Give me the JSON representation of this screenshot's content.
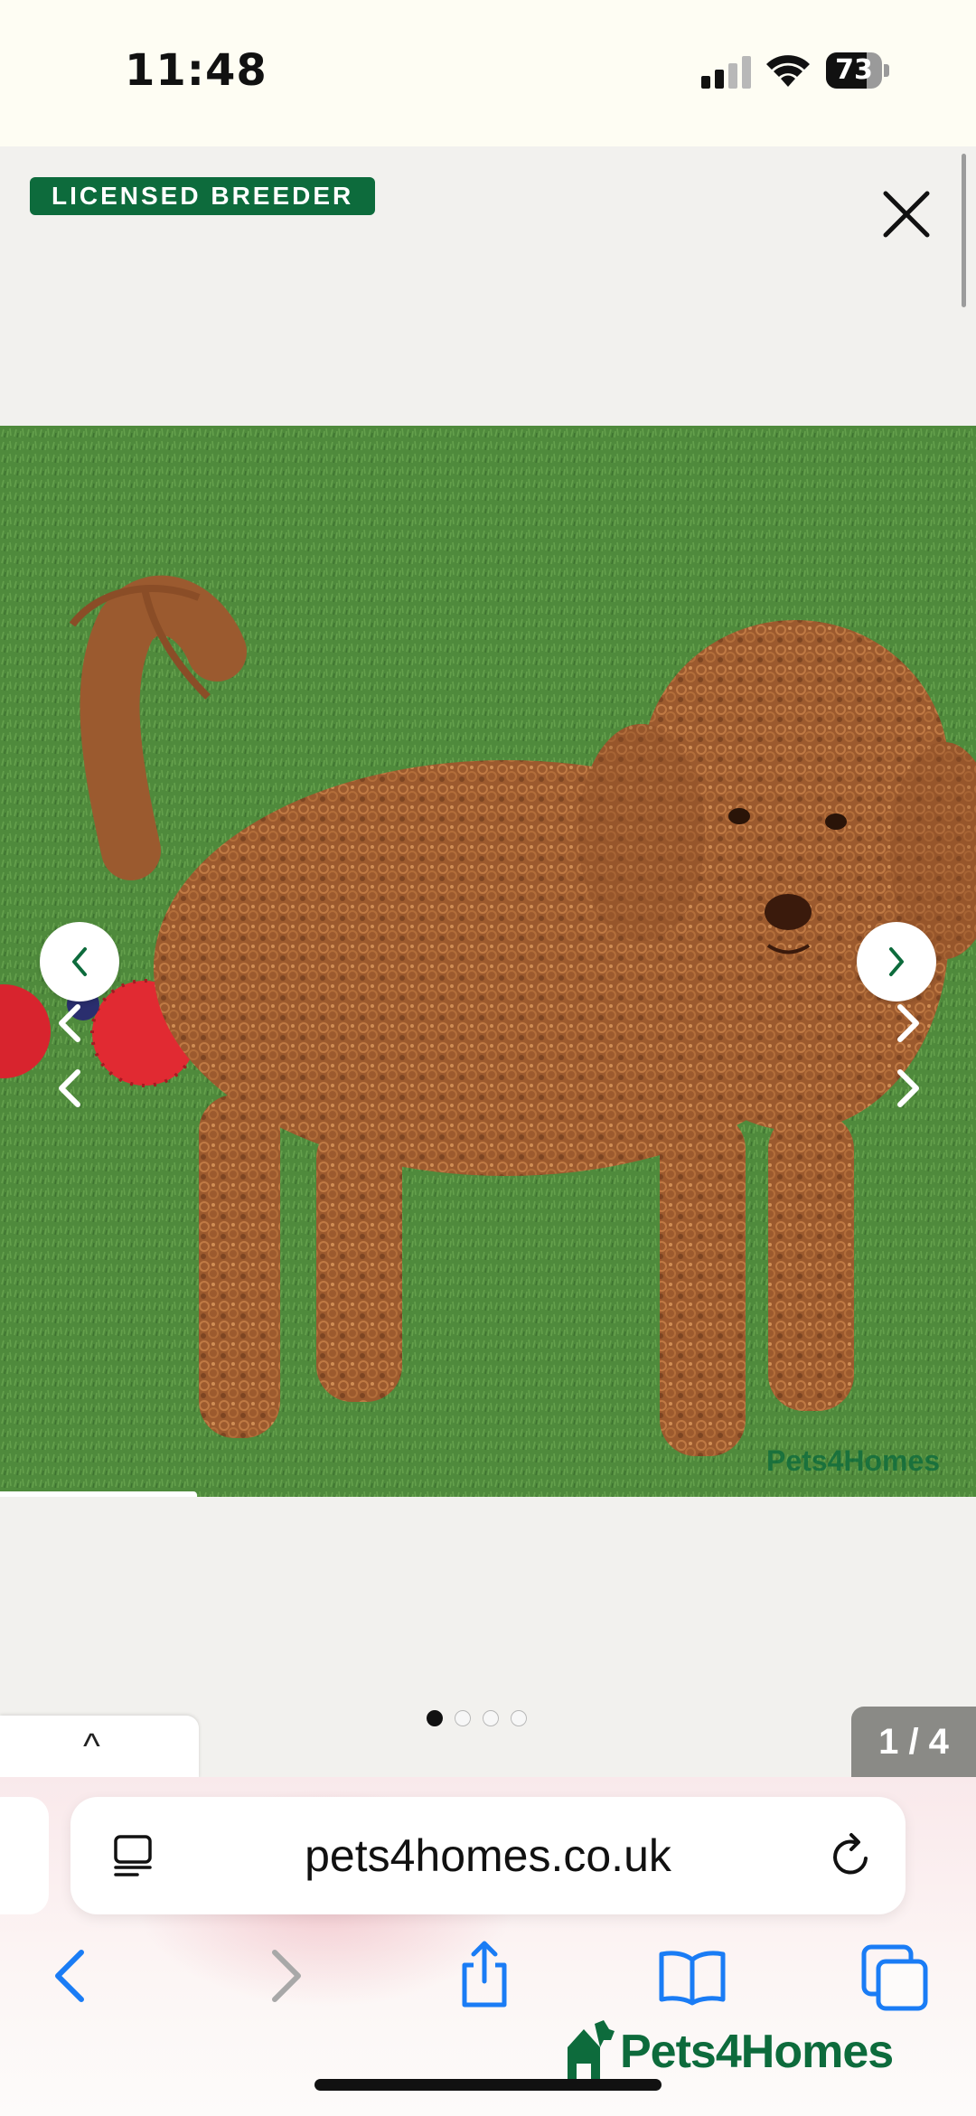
{
  "status_bar": {
    "time": "11:48",
    "battery_percent": "73",
    "battery_level": 0.73,
    "icons": [
      "cellular-signal-icon",
      "wifi-icon",
      "battery-icon"
    ]
  },
  "listing": {
    "badge": "LICENSED BREEDER",
    "close_icon": "close-icon"
  },
  "gallery": {
    "watermark": "Pets4Homes",
    "prev_icon": "chevron-left-icon",
    "next_icon": "chevron-right-icon",
    "dots": 4,
    "active_dot": 1,
    "counter": "1 / 4",
    "collapse_icon": "^"
  },
  "browser": {
    "url": "pets4homes.co.uk",
    "reader_icon": "reader-mode-icon",
    "reload_icon": "reload-icon",
    "toolbar_icons": [
      "back-icon",
      "forward-icon",
      "share-icon",
      "bookmarks-icon",
      "tabs-icon"
    ]
  },
  "footer": {
    "brand": "Pets4Homes"
  },
  "colors": {
    "brand_green": "#0d6b3c",
    "safari_blue": "#1a7cf5",
    "counter_gray": "#8a8a86"
  }
}
